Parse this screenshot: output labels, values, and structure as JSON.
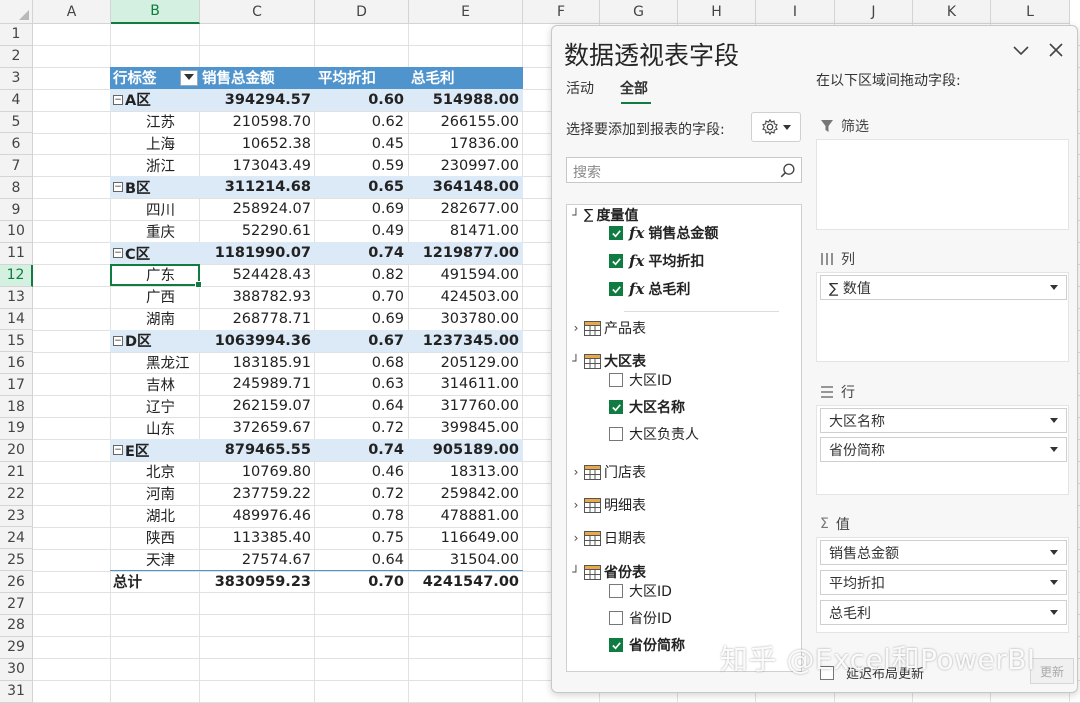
{
  "columns": [
    "A",
    "B",
    "C",
    "D",
    "E",
    "F",
    "G",
    "H",
    "I",
    "J",
    "K",
    "L"
  ],
  "selected_column": "B",
  "rows": [
    "1",
    "2",
    "3",
    "4",
    "5",
    "6",
    "7",
    "8",
    "9",
    "10",
    "11",
    "12",
    "13",
    "14",
    "15",
    "16",
    "17",
    "18",
    "19",
    "20",
    "21",
    "22",
    "23",
    "24",
    "25",
    "26",
    "27",
    "28",
    "29",
    "30",
    "31"
  ],
  "selected_row": "12",
  "pivot": {
    "headers": [
      "行标签",
      "销售总金额",
      "平均折扣",
      "总毛利"
    ],
    "groups": [
      {
        "name": "A区",
        "total": "394294.57",
        "discount": "0.60",
        "profit": "514988.00",
        "children": [
          [
            "江苏",
            "210598.70",
            "0.62",
            "266155.00"
          ],
          [
            "上海",
            "10652.38",
            "0.45",
            "17836.00"
          ],
          [
            "浙江",
            "173043.49",
            "0.59",
            "230997.00"
          ]
        ]
      },
      {
        "name": "B区",
        "total": "311214.68",
        "discount": "0.65",
        "profit": "364148.00",
        "children": [
          [
            "四川",
            "258924.07",
            "0.69",
            "282677.00"
          ],
          [
            "重庆",
            "52290.61",
            "0.49",
            "81471.00"
          ]
        ]
      },
      {
        "name": "C区",
        "total": "1181990.07",
        "discount": "0.74",
        "profit": "1219877.00",
        "children": [
          [
            "广东",
            "524428.43",
            "0.82",
            "491594.00"
          ],
          [
            "广西",
            "388782.93",
            "0.70",
            "424503.00"
          ],
          [
            "湖南",
            "268778.71",
            "0.69",
            "303780.00"
          ]
        ]
      },
      {
        "name": "D区",
        "total": "1063994.36",
        "discount": "0.67",
        "profit": "1237345.00",
        "children": [
          [
            "黑龙江",
            "183185.91",
            "0.68",
            "205129.00"
          ],
          [
            "吉林",
            "245989.71",
            "0.63",
            "314611.00"
          ],
          [
            "辽宁",
            "262159.07",
            "0.64",
            "317760.00"
          ],
          [
            "山东",
            "372659.67",
            "0.72",
            "399845.00"
          ]
        ]
      },
      {
        "name": "E区",
        "total": "879465.55",
        "discount": "0.74",
        "profit": "905189.00",
        "children": [
          [
            "北京",
            "10769.80",
            "0.46",
            "18313.00"
          ],
          [
            "河南",
            "237759.22",
            "0.72",
            "259842.00"
          ],
          [
            "湖北",
            "489976.46",
            "0.78",
            "478881.00"
          ],
          [
            "陕西",
            "113385.40",
            "0.75",
            "116649.00"
          ],
          [
            "天津",
            "27574.67",
            "0.64",
            "31504.00"
          ]
        ]
      }
    ],
    "grand_total": {
      "label": "总计",
      "total": "3830959.23",
      "discount": "0.70",
      "profit": "4241547.00"
    }
  },
  "pane": {
    "title": "数据透视表字段",
    "tabs": {
      "active_tab": "活动",
      "all_tab": "全部"
    },
    "choose_label": "选择要添加到报表的字段:",
    "search_placeholder": "搜索",
    "fields": {
      "measures": "度量值",
      "m1": "销售总金额",
      "m2": "平均折扣",
      "m3": "总毛利",
      "product_table": "产品表",
      "region_table": "大区表",
      "region_id": "大区ID",
      "region_name": "大区名称",
      "region_owner": "大区负责人",
      "store_table": "门店表",
      "detail_table": "明细表",
      "date_table": "日期表",
      "province_table": "省份表",
      "p_region_id": "大区ID",
      "p_province_id": "省份ID",
      "p_province_short": "省份简称"
    },
    "areas_hint": "在以下区域间拖动字段:",
    "filter_label": "筛选",
    "columns_label": "列",
    "columns_pill": "∑ 数值",
    "rows_label": "行",
    "rows_pills": [
      "大区名称",
      "省份简称"
    ],
    "values_label": "值",
    "values_pills": [
      "销售总金额",
      "平均折扣",
      "总毛利"
    ],
    "defer_label": "延迟布局更新",
    "update_label": "更新"
  },
  "watermark": "知乎 @Excel和PowerBI",
  "colors": {
    "accent": "#107c41",
    "pivot_header": "#4f94cd",
    "pivot_group": "#dce9f6"
  }
}
